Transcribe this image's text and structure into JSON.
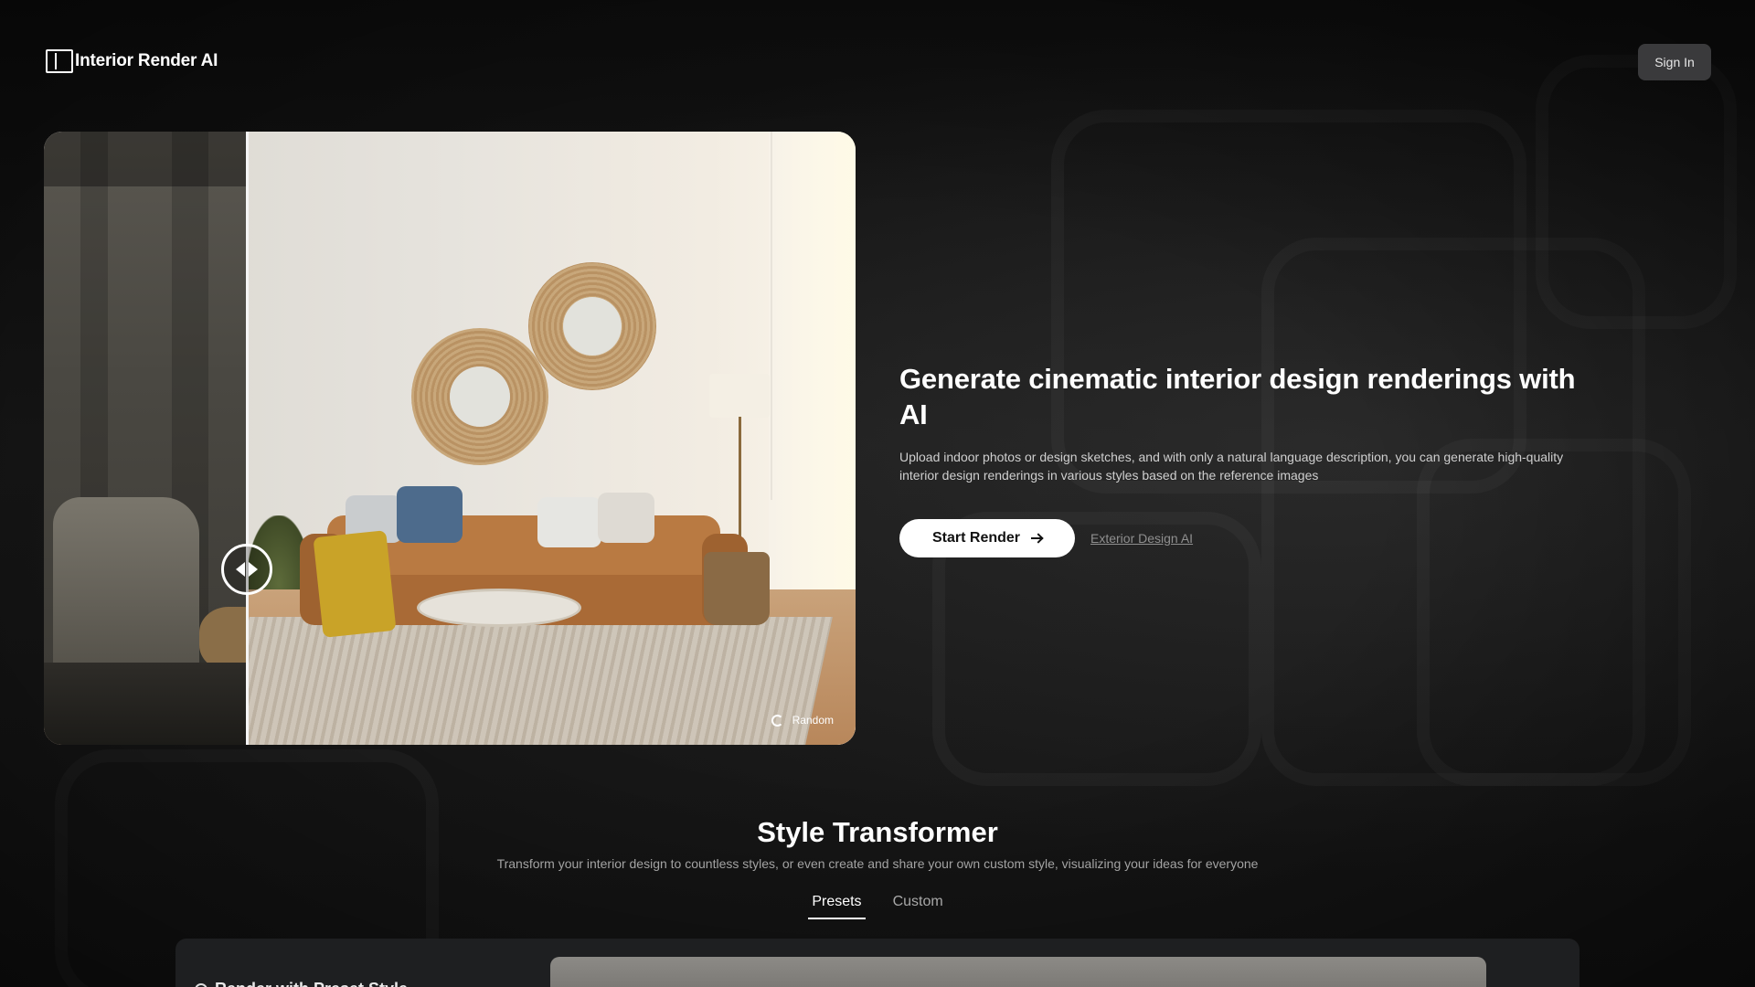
{
  "header": {
    "logo_text": "Interior Render AI",
    "signin_label": "Sign In"
  },
  "compare": {
    "random_label": "Random",
    "divider_position": 0.25
  },
  "hero": {
    "title": "Generate cinematic interior design renderings with AI",
    "description": "Upload indoor photos or design sketches, and with only a natural language description, you can generate high-quality interior design renderings in various styles based on the reference images",
    "start_label": "Start Render",
    "exterior_link": "Exterior Design AI"
  },
  "style_transformer": {
    "title": "Style Transformer",
    "subtitle": "Transform your interior design to countless styles, or even create and share your own custom style, visualizing your ideas for everyone",
    "tabs": [
      {
        "label": "Presets",
        "active": true
      },
      {
        "label": "Custom",
        "active": false
      }
    ],
    "panel_heading": "Render with Preset Style"
  },
  "colors": {
    "background": "#161616",
    "button_primary": "#ffffff",
    "signin_bg": "#3a3a3c"
  }
}
